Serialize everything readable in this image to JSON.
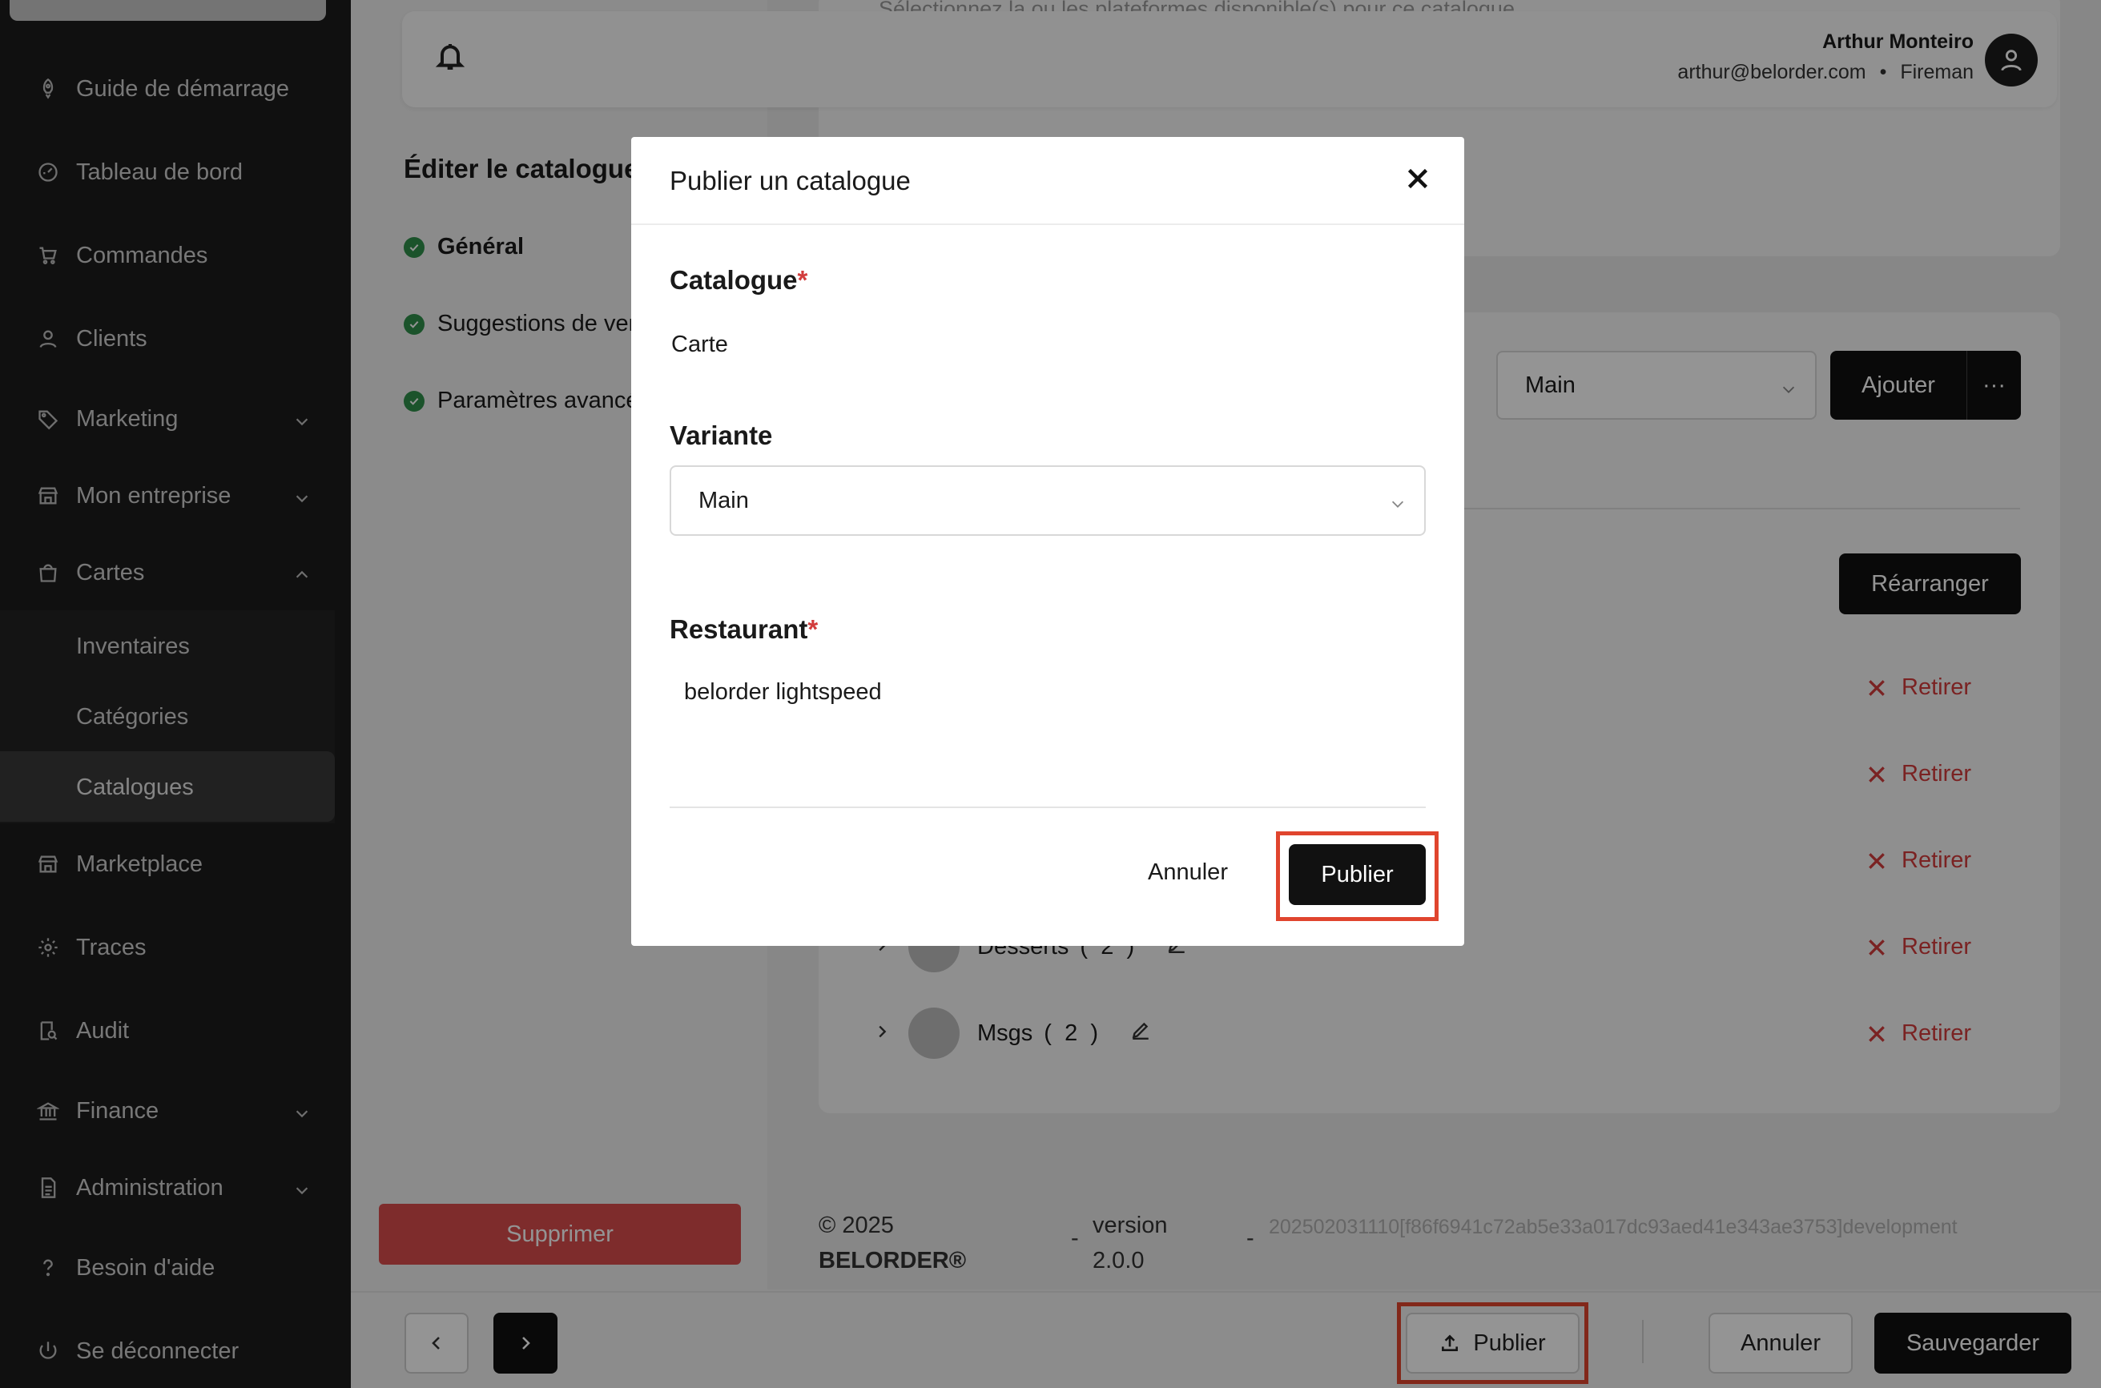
{
  "sidebar": {
    "items": [
      {
        "label": "Guide de démarrage",
        "icon": "rocket-icon"
      },
      {
        "label": "Tableau de bord",
        "icon": "dashboard-icon"
      },
      {
        "label": "Commandes",
        "icon": "cart-icon"
      },
      {
        "label": "Clients",
        "icon": "user-icon"
      },
      {
        "label": "Marketing",
        "icon": "tag-icon"
      },
      {
        "label": "Mon entreprise",
        "icon": "store-icon"
      },
      {
        "label": "Cartes",
        "icon": "bag-icon"
      },
      {
        "label": "Marketplace",
        "icon": "store-icon"
      },
      {
        "label": "Traces",
        "icon": "gear-icon"
      },
      {
        "label": "Audit",
        "icon": "audit-icon"
      },
      {
        "label": "Finance",
        "icon": "bank-icon"
      },
      {
        "label": "Administration",
        "icon": "document-icon"
      },
      {
        "label": "Besoin d'aide",
        "icon": "help-icon"
      },
      {
        "label": "Se déconnecter",
        "icon": "power-icon"
      }
    ],
    "sub_items": [
      "Inventaires",
      "Catégories",
      "Catalogues"
    ],
    "active_sub": "Catalogues"
  },
  "header": {
    "user_name": "Arthur Monteiro",
    "user_email": "arthur@belorder.com",
    "separator": "•",
    "user_role": "Fireman"
  },
  "editor": {
    "title": "Éditer le catalogue",
    "steps": [
      "Général",
      "Suggestions de vente",
      "Paramètres avancés"
    ],
    "delete_label": "Supprimer"
  },
  "content": {
    "platform_hint": "Sélectionnez la ou les plateformes disponible(s) pour ce catalogue",
    "variant_value": "Main",
    "add_label": "Ajouter",
    "more_label": "···",
    "rearrange_label": "Réarranger",
    "remove_label": "Retirer",
    "categories": [
      {
        "name": "Desserts",
        "count": "2"
      },
      {
        "name": "Msgs",
        "count": "2"
      }
    ]
  },
  "footer": {
    "copyright_year": "© 2025",
    "brand": "BELORDER®",
    "dash": "-",
    "version_label": "version",
    "version_number": "2.0.0",
    "build_hash": "202502031110[f86f6941c72ab5e33a017dc93aed41e343ae3753]development"
  },
  "bottombar": {
    "publish_label": "Publier",
    "cancel_label": "Annuler",
    "save_label": "Sauvegarder"
  },
  "modal": {
    "title": "Publier un catalogue",
    "catalogue_label": "Catalogue",
    "catalogue_value": "Carte",
    "variant_label": "Variante",
    "variant_value": "Main",
    "restaurant_label": "Restaurant",
    "restaurant_value": "belorder lightspeed",
    "required_mark": "*",
    "cancel_label": "Annuler",
    "publish_label": "Publier"
  },
  "colors": {
    "sidebar_bg": "#1c1c1c",
    "primary_dark": "#111111",
    "danger": "#d94c4c",
    "highlight": "#e0452e",
    "success": "#2f8f4a"
  }
}
